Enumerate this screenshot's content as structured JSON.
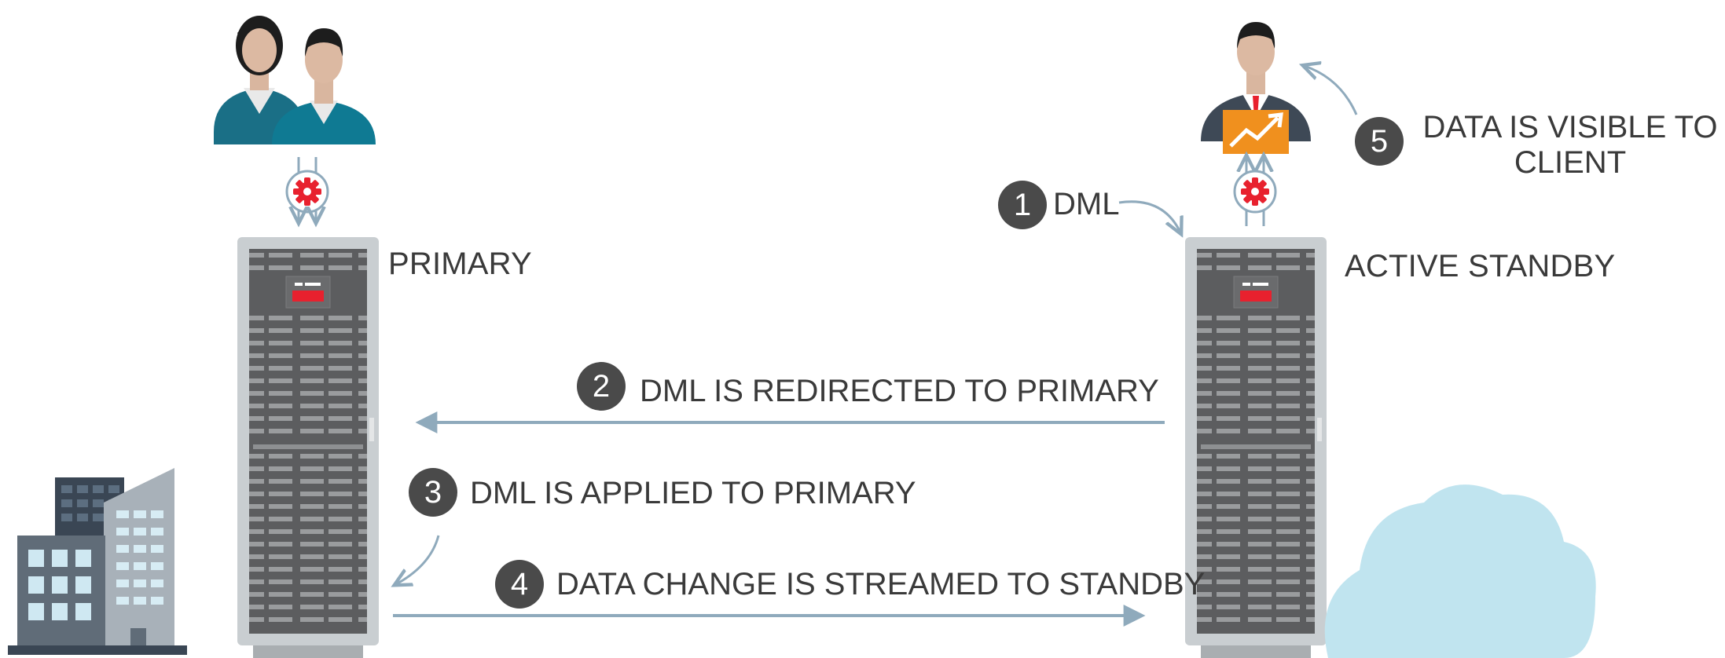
{
  "labels": {
    "primary": "PRIMARY",
    "standby": "ACTIVE STANDBY"
  },
  "steps": [
    {
      "num": "1",
      "text": "DML"
    },
    {
      "num": "2",
      "text": "DML IS REDIRECTED TO PRIMARY"
    },
    {
      "num": "3",
      "text": "DML IS APPLIED TO PRIMARY"
    },
    {
      "num": "4",
      "text": "DATA CHANGE IS STREAMED TO STANDBY"
    },
    {
      "num": "5",
      "text_line1": "DATA IS VISIBLE TO",
      "text_line2": "CLIENT"
    }
  ],
  "icons": {
    "users": "two-users-icon",
    "client": "business-user-icon",
    "chart": "trend-chart-icon",
    "gear": "gear-icon",
    "server": "server-rack-icon",
    "building": "office-building-icon",
    "cloud": "cloud-icon"
  },
  "colors": {
    "arrow": "#8faabc",
    "badge": "#4a4a4a",
    "rack": "#c9ced1",
    "rack_dark": "#58595b",
    "teal": "#1f6f86",
    "gear_red": "#e8212e",
    "chart_orange": "#f0901e",
    "cloud": "#bfe3ef",
    "building": "#5f6f80"
  }
}
